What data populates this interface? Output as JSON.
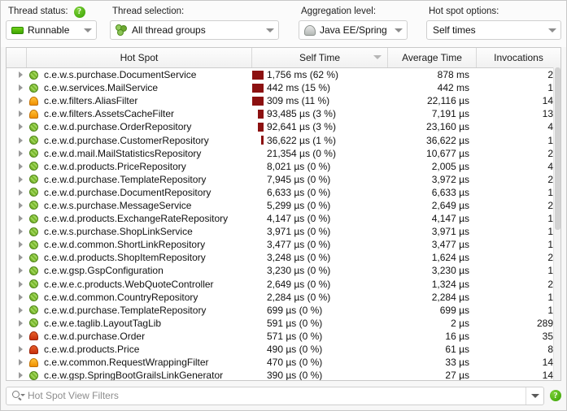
{
  "toolbar": {
    "thread_status": {
      "label": "Thread status:",
      "value": "Runnable",
      "icon": "thread-status-runnable-icon",
      "help_icon": "help-icon"
    },
    "thread_selection": {
      "label": "Thread selection:",
      "value": "All thread groups",
      "icon": "thread-groups-icon"
    },
    "aggregation_level": {
      "label": "Aggregation level:",
      "value": "Java EE/Spring",
      "icon": "aggregation-dome-icon"
    },
    "hot_spot_options": {
      "label": "Hot spot options:",
      "value": "Self times"
    }
  },
  "table": {
    "columns": [
      {
        "key": "icon",
        "label": ""
      },
      {
        "key": "hot_spot",
        "label": "Hot Spot"
      },
      {
        "key": "self_time",
        "label": "Self Time",
        "sorted": true
      },
      {
        "key": "average_time",
        "label": "Average Time"
      },
      {
        "key": "invocations",
        "label": "Invocations"
      }
    ],
    "rows": [
      {
        "icon": "bean-green",
        "name": "c.e.w.s.purchase.DocumentService",
        "self_time": "1,756 ms (62 %)",
        "bar_pct": 62,
        "average_time": "878 ms",
        "invocations": "2"
      },
      {
        "icon": "bean-green",
        "name": "c.e.w.services.MailService",
        "self_time": "442 ms (15 %)",
        "bar_pct": 15,
        "average_time": "442 ms",
        "invocations": "1"
      },
      {
        "icon": "dome-orange",
        "name": "c.e.w.filters.AliasFilter",
        "self_time": "309 ms (11 %)",
        "bar_pct": 11,
        "average_time": "22,116 µs",
        "invocations": "14"
      },
      {
        "icon": "dome-orange",
        "name": "c.e.w.filters.AssetsCacheFilter",
        "self_time": "93,485 µs (3 %)",
        "bar_pct": 3,
        "average_time": "7,191 µs",
        "invocations": "13"
      },
      {
        "icon": "bean-green",
        "name": "c.e.w.d.purchase.OrderRepository",
        "self_time": "92,641 µs (3 %)",
        "bar_pct": 3,
        "average_time": "23,160 µs",
        "invocations": "4"
      },
      {
        "icon": "bean-green",
        "name": "c.e.w.d.purchase.CustomerRepository",
        "self_time": "36,622 µs (1 %)",
        "bar_pct": 1,
        "average_time": "36,622 µs",
        "invocations": "1"
      },
      {
        "icon": "bean-green",
        "name": "c.e.w.d.mail.MailStatisticsRepository",
        "self_time": "21,354 µs (0 %)",
        "bar_pct": 0,
        "average_time": "10,677 µs",
        "invocations": "2"
      },
      {
        "icon": "bean-green",
        "name": "c.e.w.d.products.PriceRepository",
        "self_time": "8,021 µs (0 %)",
        "bar_pct": 0,
        "average_time": "2,005 µs",
        "invocations": "4"
      },
      {
        "icon": "bean-green",
        "name": "c.e.w.d.purchase.TemplateRepository",
        "self_time": "7,945 µs (0 %)",
        "bar_pct": 0,
        "average_time": "3,972 µs",
        "invocations": "2"
      },
      {
        "icon": "bean-green",
        "name": "c.e.w.d.purchase.DocumentRepository",
        "self_time": "6,633 µs (0 %)",
        "bar_pct": 0,
        "average_time": "6,633 µs",
        "invocations": "1"
      },
      {
        "icon": "bean-green",
        "name": "c.e.w.s.purchase.MessageService",
        "self_time": "5,299 µs (0 %)",
        "bar_pct": 0,
        "average_time": "2,649 µs",
        "invocations": "2"
      },
      {
        "icon": "bean-green",
        "name": "c.e.w.d.products.ExchangeRateRepository",
        "self_time": "4,147 µs (0 %)",
        "bar_pct": 0,
        "average_time": "4,147 µs",
        "invocations": "1"
      },
      {
        "icon": "bean-green",
        "name": "c.e.w.s.purchase.ShopLinkService",
        "self_time": "3,971 µs (0 %)",
        "bar_pct": 0,
        "average_time": "3,971 µs",
        "invocations": "1"
      },
      {
        "icon": "bean-green",
        "name": "c.e.w.d.common.ShortLinkRepository",
        "self_time": "3,477 µs (0 %)",
        "bar_pct": 0,
        "average_time": "3,477 µs",
        "invocations": "1"
      },
      {
        "icon": "bean-green",
        "name": "c.e.w.d.products.ShopItemRepository",
        "self_time": "3,248 µs (0 %)",
        "bar_pct": 0,
        "average_time": "1,624 µs",
        "invocations": "2"
      },
      {
        "icon": "bean-green",
        "name": "c.e.w.gsp.GspConfiguration",
        "self_time": "3,230 µs (0 %)",
        "bar_pct": 0,
        "average_time": "3,230 µs",
        "invocations": "1"
      },
      {
        "icon": "bean-green",
        "name": "c.e.w.e.c.products.WebQuoteController",
        "self_time": "2,649 µs (0 %)",
        "bar_pct": 0,
        "average_time": "1,324 µs",
        "invocations": "2"
      },
      {
        "icon": "bean-green",
        "name": "c.e.w.d.common.CountryRepository",
        "self_time": "2,284 µs (0 %)",
        "bar_pct": 0,
        "average_time": "2,284 µs",
        "invocations": "1"
      },
      {
        "icon": "bean-green",
        "name": "c.e.w.d.purchase.TemplateRepository",
        "self_time": "699 µs (0 %)",
        "bar_pct": 0,
        "average_time": "699 µs",
        "invocations": "1"
      },
      {
        "icon": "bean-green",
        "name": "c.e.w.e.taglib.LayoutTagLib",
        "self_time": "591 µs (0 %)",
        "bar_pct": 0,
        "average_time": "2 µs",
        "invocations": "289"
      },
      {
        "icon": "dome-red",
        "name": "c.e.w.d.purchase.Order",
        "self_time": "571 µs (0 %)",
        "bar_pct": 0,
        "average_time": "16 µs",
        "invocations": "35"
      },
      {
        "icon": "dome-red",
        "name": "c.e.w.d.products.Price",
        "self_time": "490 µs (0 %)",
        "bar_pct": 0,
        "average_time": "61 µs",
        "invocations": "8"
      },
      {
        "icon": "dome-orange",
        "name": "c.e.w.common.RequestWrappingFilter",
        "self_time": "470 µs (0 %)",
        "bar_pct": 0,
        "average_time": "33 µs",
        "invocations": "14"
      },
      {
        "icon": "bean-green",
        "name": "c.e.w.gsp.SpringBootGrailsLinkGenerator",
        "self_time": "390 µs (0 %)",
        "bar_pct": 0,
        "average_time": "27 µs",
        "invocations": "14"
      }
    ]
  },
  "filter_bar": {
    "placeholder": "Hot Spot View Filters",
    "value": "",
    "search_icon": "search-icon",
    "dropdown_icon": "chevron-down-icon",
    "help_icon": "help-icon"
  },
  "colors": {
    "bar": "#8c1111",
    "accent_green": "#46a000"
  }
}
